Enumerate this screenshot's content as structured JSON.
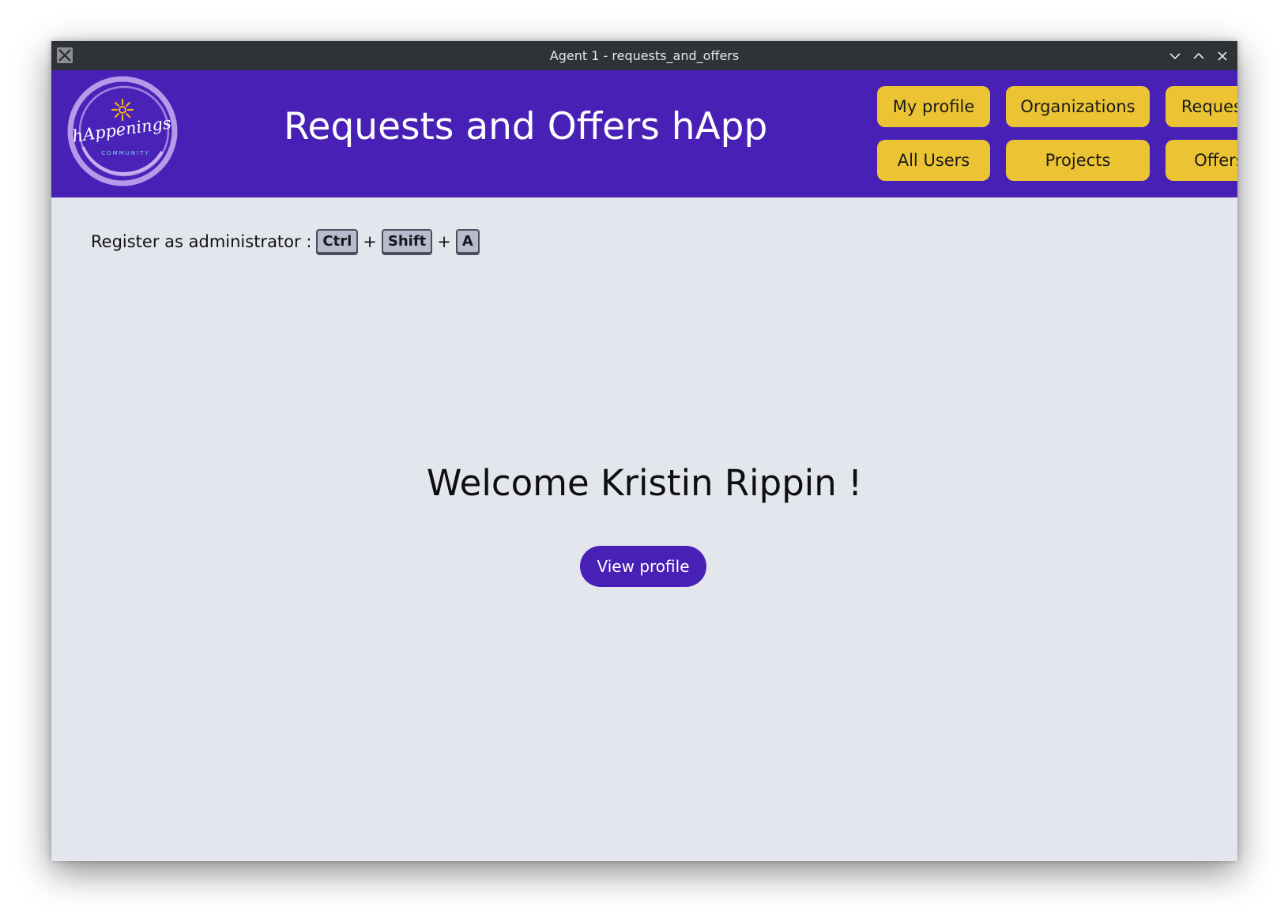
{
  "window": {
    "title": "Agent 1 - requests_and_offers"
  },
  "header": {
    "logo_text": "hAppenings",
    "logo_subtext": "COMMUNITY",
    "title": "Requests and Offers hApp",
    "nav": {
      "my_profile": "My profile",
      "organizations": "Organizations",
      "requests": "Requests",
      "all_users": "All Users",
      "projects": "Projects",
      "offers": "Offers"
    }
  },
  "main": {
    "admin_hint": {
      "label": "Register as administrator :",
      "keys": [
        "Ctrl",
        "Shift",
        "A"
      ],
      "separator": "+"
    },
    "welcome": "Welcome Kristin Rippin !",
    "view_profile_label": "View profile"
  },
  "colors": {
    "header_bg": "#4820b6",
    "nav_button_bg": "#ecc433",
    "content_bg": "#e4e6ee",
    "titlebar_bg": "#2f3236"
  },
  "icons": {
    "app": "x-window-icon",
    "minimize": "chevron-down-icon",
    "maximize": "chevron-up-icon",
    "close": "close-icon"
  }
}
